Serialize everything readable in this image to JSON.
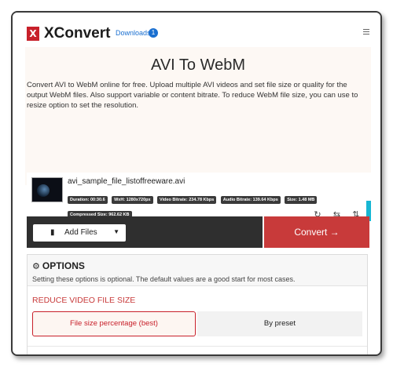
{
  "header": {
    "logo_letter": "X",
    "brand": "XConvert",
    "downloads_label": "Downloads",
    "downloads_count": "1"
  },
  "hero": {
    "title": "AVI To WebM",
    "description": "Convert AVI to WebM online for free. Upload multiple AVI videos and set file size or quality for the output WebM files. Also support variable or content bitrate. To reduce WebM file size, you can use to resize option to set the resolution."
  },
  "file": {
    "name": "avi_sample_file_listoffreeware.avi",
    "chips": [
      "Duration: 00:30.6",
      "WxH: 1280x720px",
      "Video Bitrate: 234.78 Kbps",
      "Audio Bitrate: 139.64 Kbps",
      "Size: 1.48 MB",
      "Compressed Size: 962.62 KB"
    ],
    "actions": [
      "rotate-icon",
      "swap-icon",
      "sort-icon",
      "close-icon"
    ]
  },
  "actions": {
    "add_files_label": "Add Files",
    "convert_label": "Convert →"
  },
  "options": {
    "title": "OPTIONS",
    "description": "Setting these options is optional. The default values are a good start for most cases.",
    "reduce_label": "REDUCE VIDEO FILE SIZE",
    "mode_selected": "File size percentage (best)",
    "mode_other": "By preset"
  },
  "colors": {
    "brand_red": "#c8202a",
    "convert_red": "#c83a3a",
    "link_blue": "#1a6fd0",
    "dark_bar": "#2f2f2f",
    "accent_cyan": "#17b6d3"
  }
}
